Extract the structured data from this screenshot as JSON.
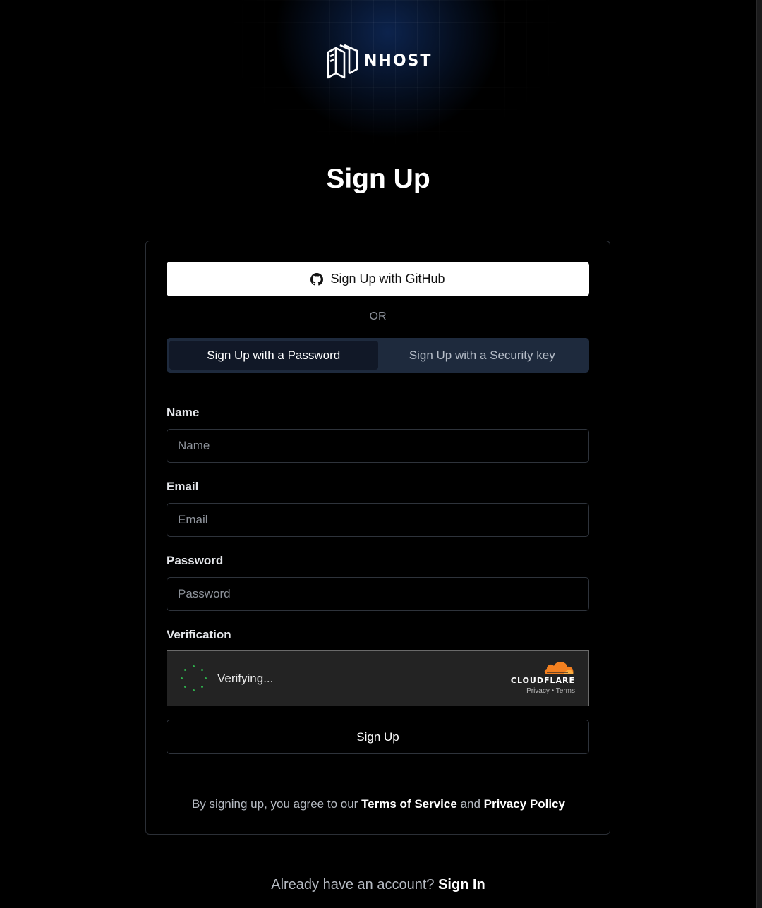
{
  "brand": {
    "logo_text": "NHOST"
  },
  "page": {
    "title": "Sign Up"
  },
  "social": {
    "github_label": "Sign Up with GitHub",
    "icon": "github-icon"
  },
  "separator": {
    "text": "OR"
  },
  "tabs": [
    {
      "label": "Sign Up with a Password",
      "active": true
    },
    {
      "label": "Sign Up with a Security key",
      "active": false
    }
  ],
  "form": {
    "name": {
      "label": "Name",
      "placeholder": "Name",
      "value": ""
    },
    "email": {
      "label": "Email",
      "placeholder": "Email",
      "value": ""
    },
    "password": {
      "label": "Password",
      "placeholder": "Password",
      "value": ""
    },
    "verification": {
      "label": "Verification",
      "status": "Verifying...",
      "provider": "CLOUDFLARE",
      "privacy_link": "Privacy",
      "link_separator": "•",
      "terms_link": "Terms"
    },
    "submit_label": "Sign Up"
  },
  "legal": {
    "prefix": "By signing up, you agree to our",
    "terms_link": "Terms of Service",
    "conjunction": "and",
    "privacy_link": "Privacy Policy"
  },
  "footer": {
    "prompt": "Already have an account?",
    "signin_link": "Sign In"
  },
  "colors": {
    "background": "#000000",
    "tab_track": "#1e2a3d",
    "tab_active": "#111827",
    "cloudflare_orange": "#f38020",
    "spinner_green": "#2fae4c"
  }
}
